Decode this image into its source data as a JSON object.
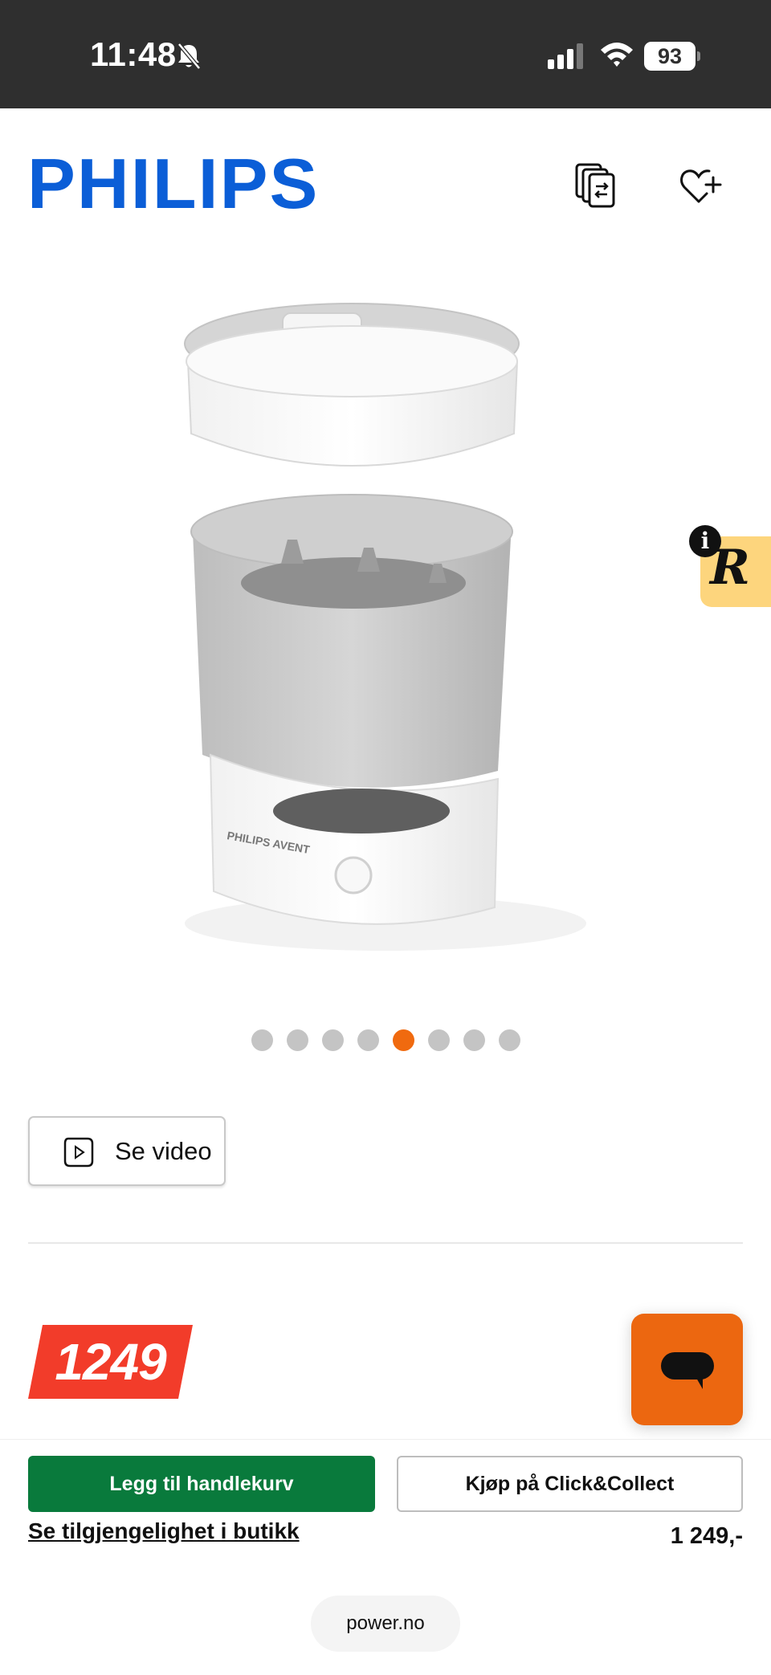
{
  "status_bar": {
    "time": "11:48",
    "battery": "93",
    "icons": [
      "bell-slash-icon",
      "signal-icon",
      "wifi-icon",
      "battery-icon"
    ]
  },
  "header": {
    "brand": "PHILIPS",
    "icons": [
      "compare-icon",
      "wishlist-heart-plus-icon"
    ],
    "brand_color": "#0b5ed7"
  },
  "gallery": {
    "product_label": "PHILIPS AVENT",
    "total_images": 8,
    "active_index": 4
  },
  "video": {
    "label": "Se video"
  },
  "price": {
    "badge": "1249",
    "badge_color": "#f23c2a"
  },
  "widgets": {
    "info_badge": "i",
    "r_letter": "R",
    "chat_color": "#ec6710"
  },
  "actions": {
    "add_to_cart": "Legg til handlekurv",
    "click_collect": "Kjøp på Click&Collect",
    "store_link": "Se tilgjengelighet i butikk",
    "price": "1 249,-",
    "add_to_cart_color": "#097a3c"
  },
  "browser": {
    "domain": "power.no"
  }
}
